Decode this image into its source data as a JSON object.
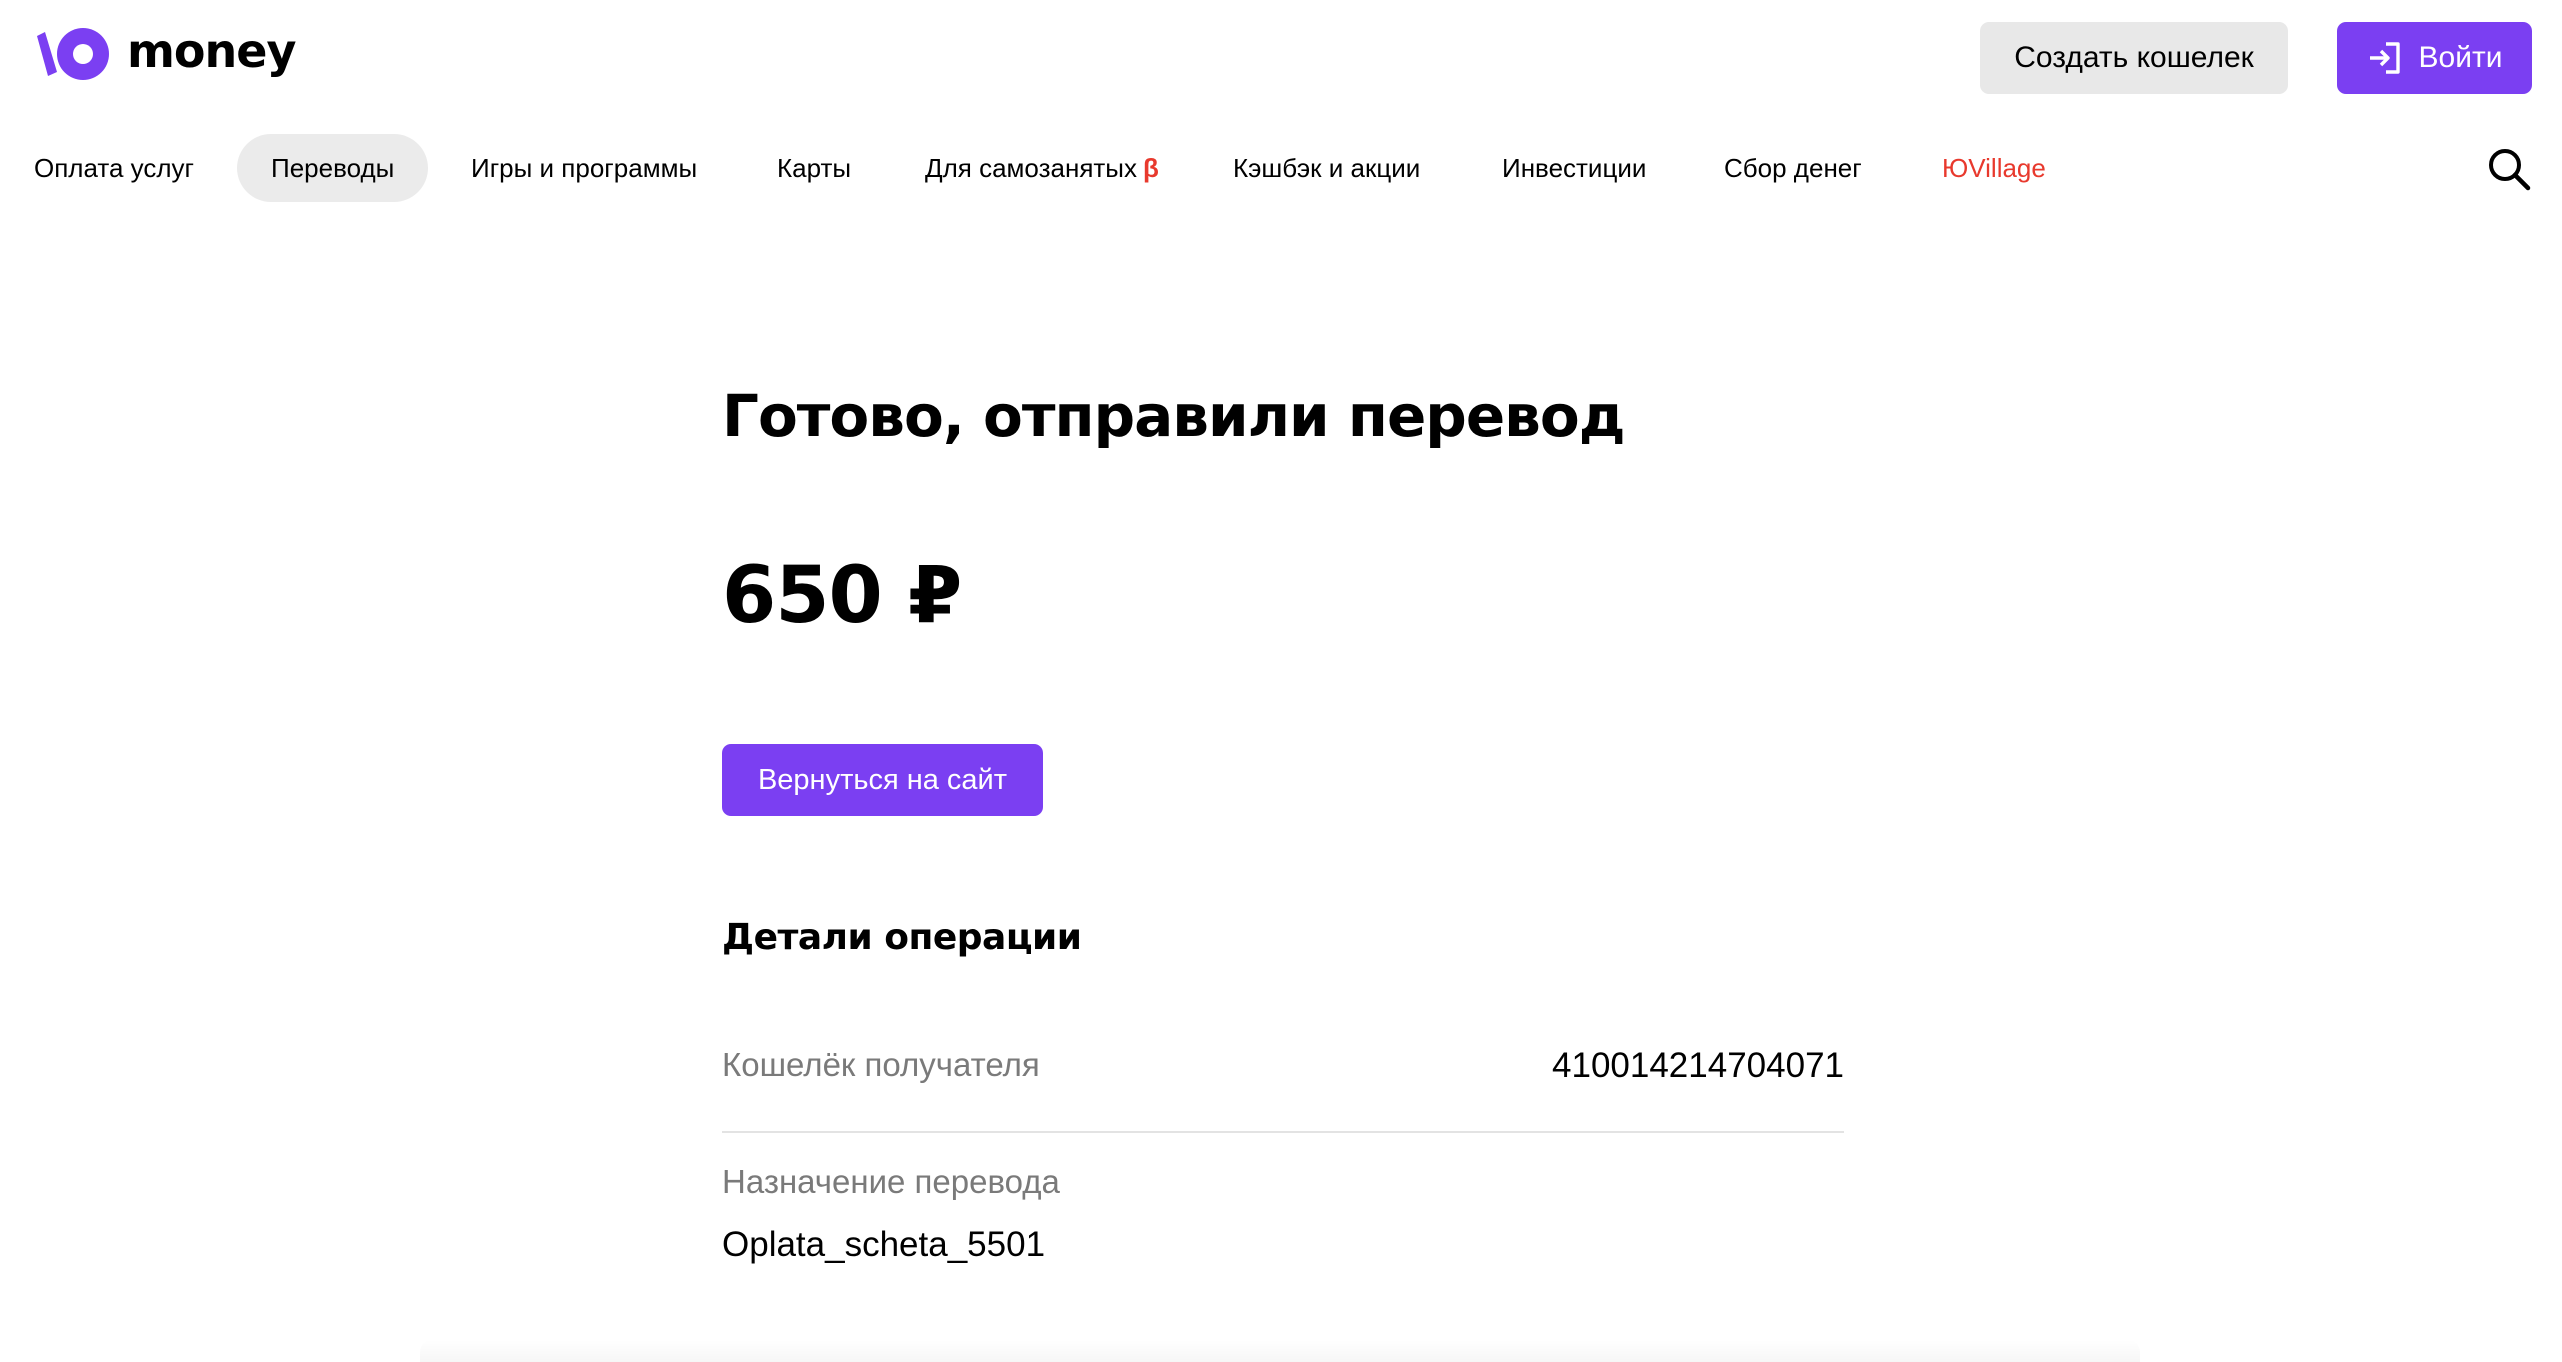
{
  "header": {
    "logo_text": "money",
    "create_wallet_label": "Создать кошелек",
    "login_label": "Войти"
  },
  "nav": {
    "items": [
      {
        "label": "Оплата услуг"
      },
      {
        "label": "Переводы",
        "active": true
      },
      {
        "label": "Игры и программы"
      },
      {
        "label": "Карты"
      },
      {
        "label": "Для самозанятых",
        "badge": "β"
      },
      {
        "label": "Кэшбэк и акции"
      },
      {
        "label": "Инвестиции"
      },
      {
        "label": "Сбор денег"
      },
      {
        "label": "ЮVillage",
        "color": "#e8392d"
      }
    ]
  },
  "main": {
    "title": "Готово, отправили перевод",
    "amount": "650 ₽",
    "back_button_label": "Вернуться на сайт",
    "details_title": "Детали операции",
    "details": [
      {
        "label": "Кошелёк получателя",
        "value": "410014214704071"
      },
      {
        "label": "Назначение перевода",
        "value": "Oplata_scheta_5501"
      }
    ]
  },
  "colors": {
    "accent": "#7b3ff2",
    "highlight_red": "#e8392d",
    "secondary_button": "#e8e8e8",
    "muted_text": "#7a7a7a"
  },
  "icons": {
    "logo": "yoomoney-logo-icon",
    "login": "login-arrow-icon",
    "search": "search-icon"
  }
}
